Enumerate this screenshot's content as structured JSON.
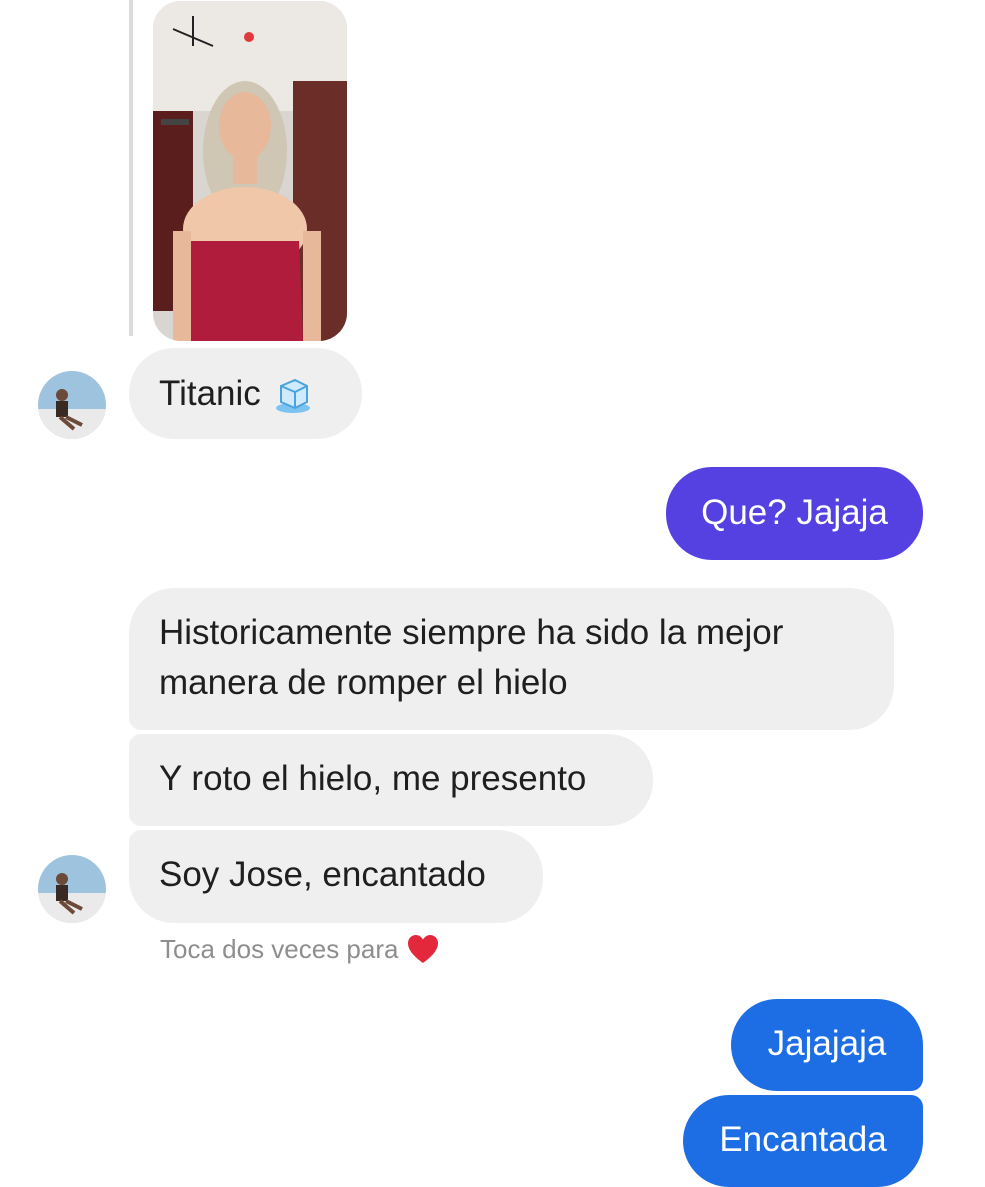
{
  "conversation": {
    "messages": [
      {
        "sender": "contact",
        "type": "image",
        "alt": ""
      },
      {
        "sender": "contact",
        "text": "Titanic",
        "icon": "ice-cube-icon"
      },
      {
        "sender": "me",
        "text": "Que? Jajaja",
        "color": "#5540e2"
      },
      {
        "sender": "contact",
        "text": "Historicamente siempre ha sido la mejor manera de romper el hielo"
      },
      {
        "sender": "contact",
        "text": "Y roto el hielo, me presento"
      },
      {
        "sender": "contact",
        "text": "Soy Jose, encantado"
      },
      {
        "sender": "me",
        "text": "Jajajaja",
        "color": "#1d6ee5"
      },
      {
        "sender": "me",
        "text": "Encantada",
        "color": "#1d6ee5"
      }
    ],
    "double_tap_hint": "Toca dos veces para",
    "double_tap_icon": "heart-icon"
  },
  "colors": {
    "incoming_bubble": "#efefef",
    "outgoing_purple": "#5540e2",
    "outgoing_blue": "#1d6ee5",
    "hint_text": "#8e8e8e"
  }
}
